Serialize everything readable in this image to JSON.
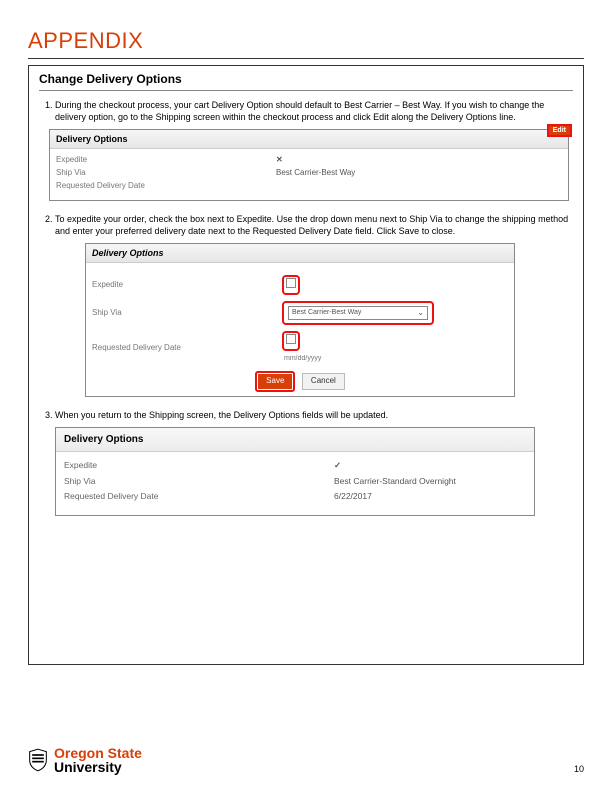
{
  "appendix_title": "APPENDIX",
  "section_title": "Change Delivery Options",
  "steps": {
    "s1": {
      "text": "During the checkout process, your cart Delivery Option should default to Best Carrier – Best Way. If you wish to change the delivery option, go to the Shipping screen within the checkout process and click Edit along the Delivery Options line.",
      "shot_header": "Delivery Options",
      "edit_label": "Edit",
      "rows": {
        "expedite_label": "Expedite",
        "expedite_value": "✕",
        "shipvia_label": "Ship Via",
        "shipvia_value": "Best Carrier-Best Way",
        "reqdate_label": "Requested Delivery Date",
        "reqdate_value": ""
      }
    },
    "s2": {
      "text": "To expedite your order, check the box next to Expedite. Use the drop down menu next to Ship Via to change the shipping method and enter your preferred delivery date next to the Requested Delivery Date field. Click Save to close.",
      "shot_header": "Delivery Options",
      "rows": {
        "expedite_label": "Expedite",
        "shipvia_label": "Ship Via",
        "shipvia_value": "Best Carrier-Best Way",
        "reqdate_label": "Requested Delivery Date",
        "date_placeholder": "mm/dd/yyyy"
      },
      "save_label": "Save",
      "cancel_label": "Cancel"
    },
    "s3": {
      "text": "When you return to the Shipping screen, the Delivery Options fields will be updated.",
      "shot_header": "Delivery Options",
      "rows": {
        "expedite_label": "Expedite",
        "expedite_value": "✓",
        "shipvia_label": "Ship Via",
        "shipvia_value": "Best Carrier-Standard Overnight",
        "reqdate_label": "Requested Delivery Date",
        "reqdate_value": "6/22/2017"
      }
    }
  },
  "footer": {
    "org_line1": "Oregon State",
    "org_line2": "University",
    "page_number": "10"
  }
}
